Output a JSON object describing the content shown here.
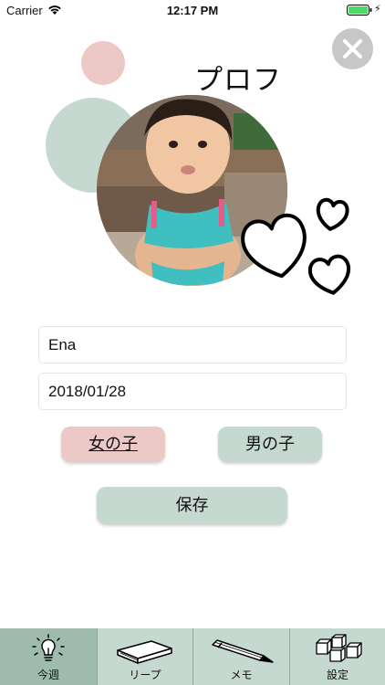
{
  "status_bar": {
    "carrier": "Carrier",
    "time": "12:17 PM",
    "battery_color": "#4cd964"
  },
  "header": {
    "title": "プロフ"
  },
  "form": {
    "name_value": "Ena",
    "birthday_value": "2018/01/28",
    "girl_label": "女の子",
    "boy_label": "男の子",
    "save_label": "保存"
  },
  "tabbar": {
    "items": [
      {
        "label": "今週",
        "icon": "lightbulb-icon",
        "active": true
      },
      {
        "label": "リープ",
        "icon": "book-icon",
        "active": false
      },
      {
        "label": "メモ",
        "icon": "pencil-icon",
        "active": false
      },
      {
        "label": "設定",
        "icon": "blocks-icon",
        "active": false
      }
    ]
  },
  "colors": {
    "pink": "#ecc9c6",
    "green": "#c5d9d0",
    "tab_active": "#9fbbae"
  }
}
